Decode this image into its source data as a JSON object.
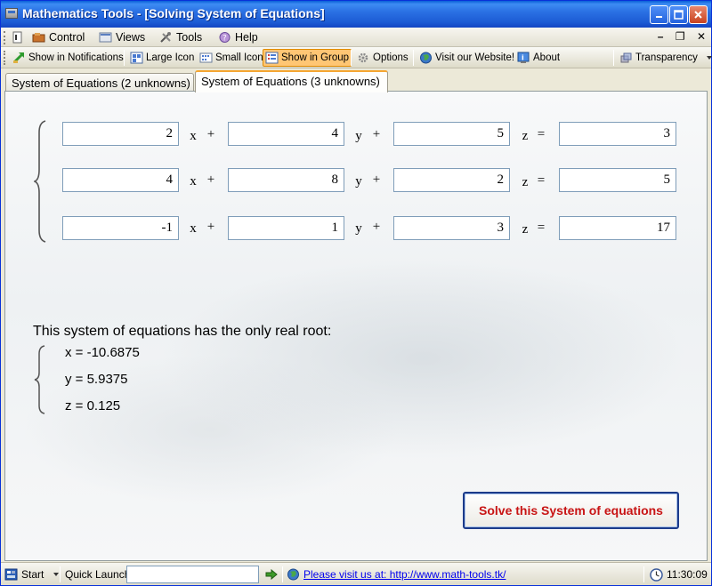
{
  "window": {
    "title": "Mathematics Tools - [Solving System of Equations]"
  },
  "menu": {
    "control": "Control",
    "views": "Views",
    "tools": "Tools",
    "help": "Help",
    "mdi_minimize": "–",
    "mdi_restore": "❐",
    "mdi_close": "✕"
  },
  "toolbar": {
    "show_in_notifications": "Show in Notifications",
    "large_icon": "Large Icon",
    "small_icon": "Small Icon",
    "show_in_group": "Show in Group",
    "options": "Options",
    "visit_website": "Visit our Website!",
    "about": "About",
    "transparency": "Transparency"
  },
  "tabs": {
    "two_unknowns": "System of Equations (2 unknowns)",
    "three_unknowns": "System of Equations (3 unknowns)"
  },
  "equations": [
    {
      "a": "2",
      "b": "4",
      "c": "5",
      "d": "3"
    },
    {
      "a": "4",
      "b": "8",
      "c": "2",
      "d": "5"
    },
    {
      "a": "-1",
      "b": "1",
      "c": "3",
      "d": "17"
    }
  ],
  "symbols": {
    "x": "x",
    "y": "y",
    "z": "z",
    "plus": "+",
    "equals": "="
  },
  "result": {
    "caption": "This system of equations has the only real root:",
    "x": "x = -10.6875",
    "y": "y = 5.9375",
    "z": "z = 0.125"
  },
  "solve_button_label": "Solve this System of equations",
  "status": {
    "start": "Start",
    "quick_launch": "Quick Launch",
    "site_link": "Please visit us at: http://www.math-tools.tk/",
    "clock": "11:30:09"
  },
  "colors": {
    "title_blue": "#2b71e4",
    "solve_text": "#c81414",
    "active_tab_accent": "#f5a630",
    "active_tool": "#ffc674"
  }
}
